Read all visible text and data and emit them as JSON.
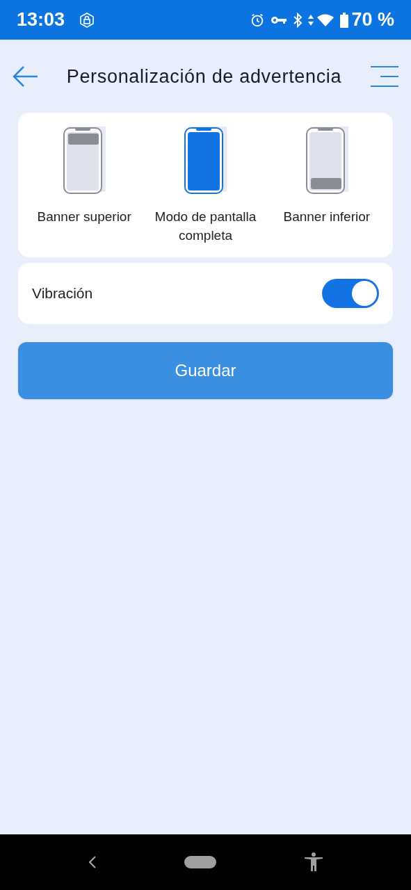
{
  "status_bar": {
    "time": "13:03",
    "battery": "70 %"
  },
  "header": {
    "title": "Personalización de advertencia"
  },
  "modes": [
    {
      "kind": "top",
      "label": "Banner superior",
      "selected": false
    },
    {
      "kind": "full",
      "label": "Modo de pantalla completa",
      "selected": true
    },
    {
      "kind": "bottom",
      "label": "Banner inferior",
      "selected": false
    }
  ],
  "vibration": {
    "label": "Vibración",
    "on": true
  },
  "save_button": "Guardar"
}
